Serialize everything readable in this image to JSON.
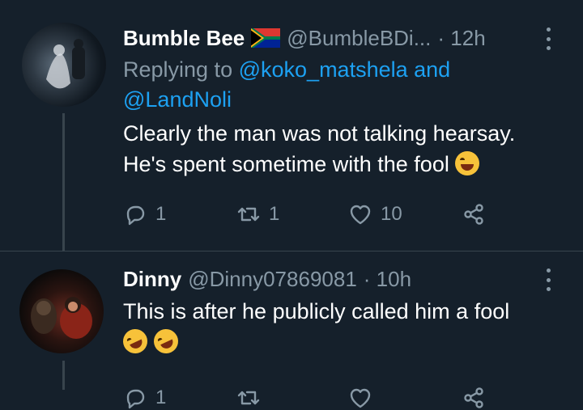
{
  "tweets": [
    {
      "name": "Bumble Bee",
      "handle": "@BumbleBDi...",
      "time": "· 12h",
      "replying_prefix": "Replying to",
      "replying_to_1": "@koko_matshela",
      "replying_and": "and",
      "replying_to_2": "@LandNoli",
      "text_line1": "Clearly the man was not talking hearsay.",
      "text_line2": "He's spent sometime with the fool",
      "reply_count": "1",
      "retweet_count": "1",
      "like_count": "10"
    },
    {
      "name": "Dinny",
      "handle": "@Dinny07869081",
      "time": "· 10h",
      "text_line1": "This is after he publicly called him a fool",
      "reply_count": "1"
    }
  ],
  "icons": {
    "flag": "south-africa-flag-icon",
    "reply": "reply-icon",
    "retweet": "retweet-icon",
    "like": "heart-icon",
    "share": "share-icon",
    "more": "more-icon",
    "emoji1": "face-with-tears-of-joy-emoji",
    "emoji2": "rolling-on-floor-laughing-emoji"
  },
  "colors": {
    "background": "#15202b",
    "secondary_text": "#8899a6",
    "link": "#1da1f2",
    "divider": "#38444d"
  }
}
